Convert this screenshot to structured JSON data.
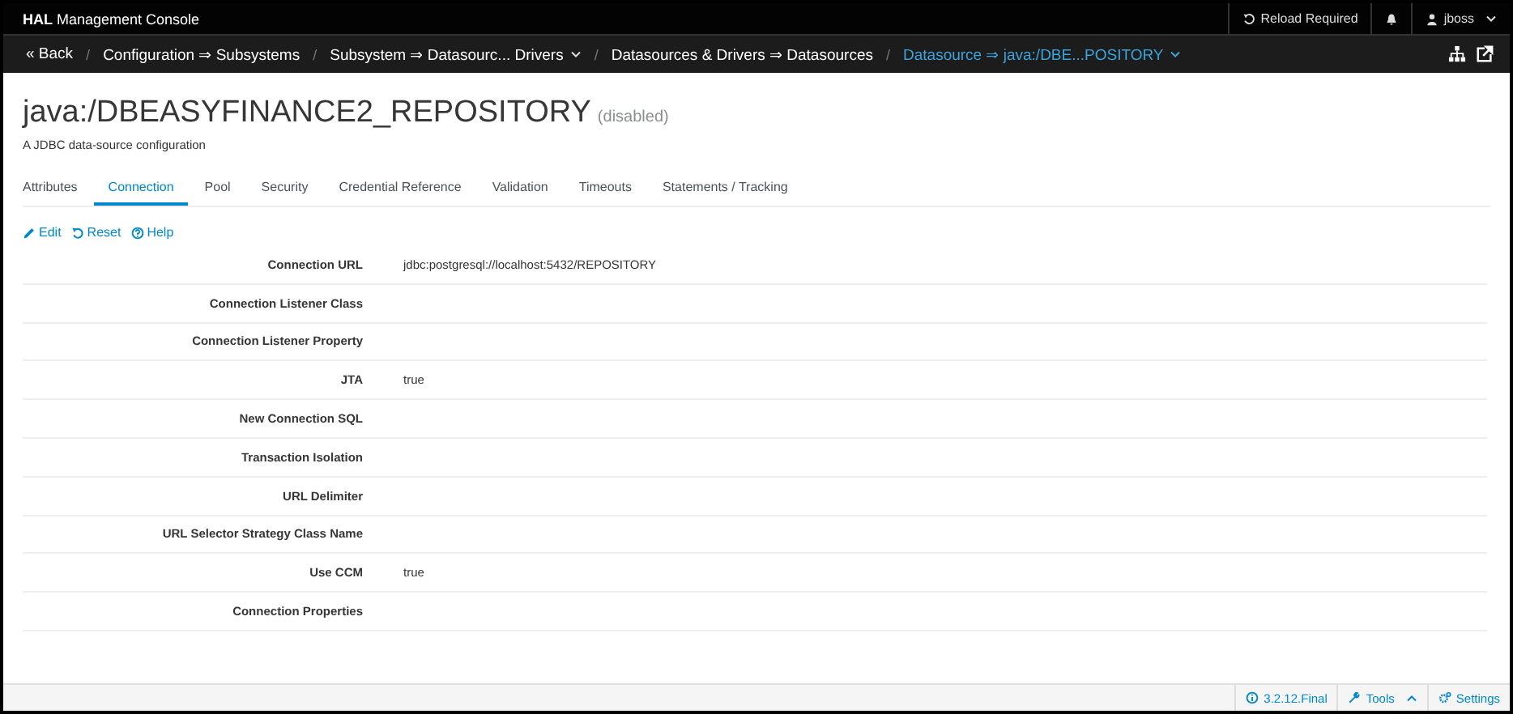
{
  "header": {
    "brand_bold": "HAL",
    "brand_rest": "Management Console",
    "reload": "Reload Required",
    "user": "jboss"
  },
  "breadcrumb": {
    "separator": "/",
    "items": [
      {
        "text": "« Back",
        "dropdown": false,
        "selected": false
      },
      {
        "text": "Configuration ⇒ Subsystems",
        "dropdown": false,
        "selected": false
      },
      {
        "text": "Subsystem ⇒ Datasourc... Drivers",
        "dropdown": true,
        "selected": false
      },
      {
        "text": "Datasources & Drivers ⇒ Datasources",
        "dropdown": false,
        "selected": false
      },
      {
        "text": "Datasource ⇒ java:/DBE...POSITORY",
        "dropdown": true,
        "selected": true
      }
    ]
  },
  "title": "java:/DBEASYFINANCE2_REPOSITORY",
  "status": "(disabled)",
  "subtitle": "A JDBC data-source configuration",
  "tabs": [
    {
      "label": "Attributes",
      "selected": false
    },
    {
      "label": "Connection",
      "selected": true
    },
    {
      "label": "Pool",
      "selected": false
    },
    {
      "label": "Security",
      "selected": false
    },
    {
      "label": "Credential Reference",
      "selected": false
    },
    {
      "label": "Validation",
      "selected": false
    },
    {
      "label": "Timeouts",
      "selected": false
    },
    {
      "label": "Statements / Tracking",
      "selected": false
    }
  ],
  "actions": [
    {
      "kind": "edit",
      "label": "Edit"
    },
    {
      "kind": "reset",
      "label": "Reset"
    },
    {
      "kind": "help",
      "label": "Help"
    }
  ],
  "attributes": [
    {
      "name": "Connection URL",
      "value": "jdbc:postgresql://localhost:5432/REPOSITORY"
    },
    {
      "name": "Connection Listener Class"
    },
    {
      "name": "Connection Listener Property"
    },
    {
      "name": "JTA",
      "value": "true"
    },
    {
      "name": "New Connection SQL"
    },
    {
      "name": "Transaction Isolation"
    },
    {
      "name": "URL Delimiter"
    },
    {
      "name": "URL Selector Strategy Class Name"
    },
    {
      "name": "Use CCM",
      "value": "true"
    },
    {
      "name": "Connection Properties"
    }
  ],
  "footer": {
    "version": "3.2.12.Final",
    "tools": "Tools",
    "settings": "Settings"
  }
}
